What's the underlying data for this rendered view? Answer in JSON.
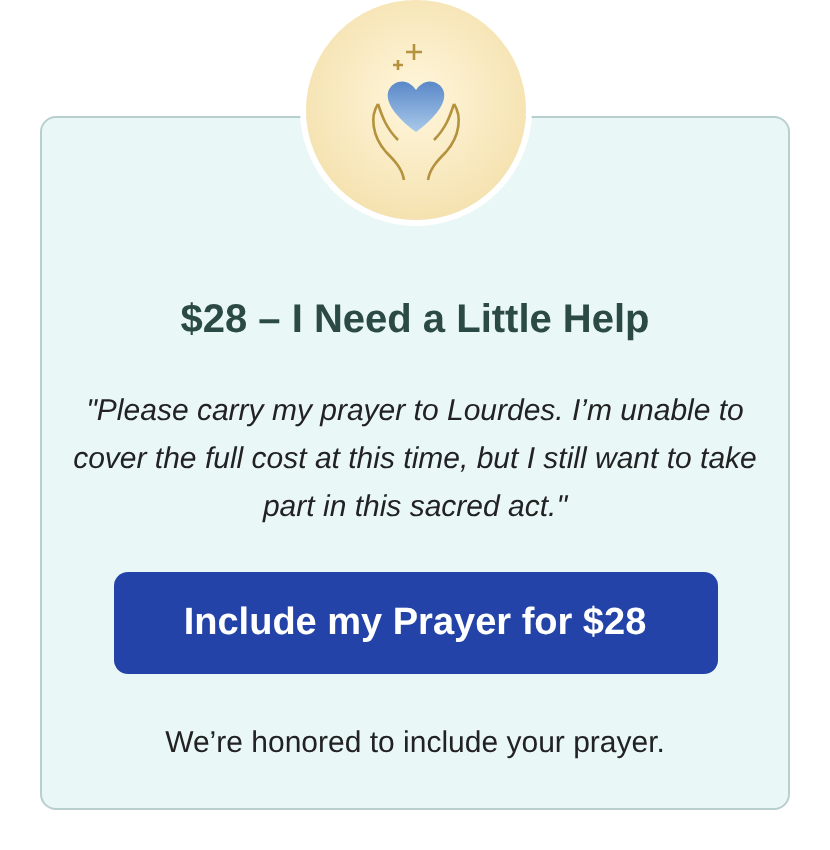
{
  "title": "$28 – I Need a Little Help",
  "quote": "\"Please carry my prayer to Lourdes. I’m unable to cover the full cost at this time, but I still want to take part in this sacred act.\"",
  "button": "Include my Prayer for $28",
  "note": "We’re honored to include your prayer."
}
